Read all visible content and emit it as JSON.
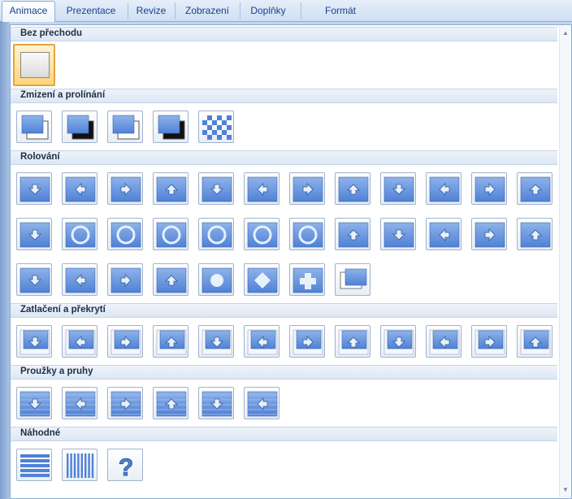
{
  "tabs": [
    {
      "label": "Animace",
      "active": true
    },
    {
      "label": "Prezentace"
    },
    {
      "label": "Revize"
    },
    {
      "label": "Zobrazení"
    },
    {
      "label": "Doplňky"
    },
    {
      "label": "Formát"
    }
  ],
  "sections": [
    {
      "title": "Bez přechodu",
      "items": [
        {
          "icon": "no-transition-icon"
        }
      ]
    },
    {
      "title": "Zmizení a prolínání",
      "items": [
        {
          "icon": "fade-smoothly-icon"
        },
        {
          "icon": "fade-through-black-icon"
        },
        {
          "icon": "cut-icon"
        },
        {
          "icon": "cut-through-black-icon"
        },
        {
          "icon": "dissolve-icon"
        }
      ]
    },
    {
      "title": "Rolování",
      "items": [
        {
          "icon": "wipe-down-icon"
        },
        {
          "icon": "wipe-left-icon"
        },
        {
          "icon": "wipe-right-icon"
        },
        {
          "icon": "wipe-up-icon"
        },
        {
          "icon": "wedge-icon"
        },
        {
          "icon": "uncover-down-icon"
        },
        {
          "icon": "uncover-left-icon"
        },
        {
          "icon": "uncover-right-icon"
        },
        {
          "icon": "uncover-up-icon"
        },
        {
          "icon": "uncover-left-down-icon"
        },
        {
          "icon": "uncover-right-down-icon"
        },
        {
          "icon": "cover-right-down-icon"
        },
        {
          "icon": "cover-left-up-icon"
        },
        {
          "icon": "box-in-icon"
        },
        {
          "icon": "box-out-icon"
        },
        {
          "icon": "wheel-clockwise-icon"
        },
        {
          "icon": "wheel-2-spokes-icon"
        },
        {
          "icon": "wheel-3-spokes-icon"
        },
        {
          "icon": "wheel-4-spokes-icon"
        },
        {
          "icon": "wheel-8-spokes-icon"
        },
        {
          "icon": "split-horizontal-in-icon"
        },
        {
          "icon": "split-horizontal-out-icon"
        },
        {
          "icon": "split-vertical-in-icon"
        },
        {
          "icon": "split-vertical-out-icon"
        },
        {
          "icon": "strips-left-down-icon"
        },
        {
          "icon": "strips-left-up-icon"
        },
        {
          "icon": "strips-right-down-icon"
        },
        {
          "icon": "strips-right-up-icon"
        },
        {
          "icon": "shape-circle-icon"
        },
        {
          "icon": "shape-diamond-icon"
        },
        {
          "icon": "shape-plus-icon"
        },
        {
          "icon": "newsflash-icon"
        }
      ]
    },
    {
      "title": "Zatlačení a překrytí",
      "items": [
        {
          "icon": "push-down-icon"
        },
        {
          "icon": "push-left-icon"
        },
        {
          "icon": "push-right-icon"
        },
        {
          "icon": "push-up-icon"
        },
        {
          "icon": "cover-down-icon"
        },
        {
          "icon": "cover-left-icon"
        },
        {
          "icon": "cover-right-icon"
        },
        {
          "icon": "cover-up-icon"
        },
        {
          "icon": "cover-left-down-icon"
        },
        {
          "icon": "cover-left-up-2-icon"
        },
        {
          "icon": "cover-right-down-2-icon"
        },
        {
          "icon": "cover-right-up-icon"
        }
      ]
    },
    {
      "title": "Proužky a pruhy",
      "items": [
        {
          "icon": "blinds-horizontal-icon"
        },
        {
          "icon": "blinds-vertical-icon"
        },
        {
          "icon": "checkerboard-across-icon"
        },
        {
          "icon": "checkerboard-down-icon"
        },
        {
          "icon": "comb-horizontal-icon"
        },
        {
          "icon": "comb-vertical-icon"
        }
      ]
    },
    {
      "title": "Náhodné",
      "items": [
        {
          "icon": "random-bars-horizontal-icon"
        },
        {
          "icon": "random-bars-vertical-icon"
        },
        {
          "icon": "random-transition-icon",
          "glyph": "?"
        }
      ]
    }
  ],
  "colors": {
    "accent": "#4f81d6",
    "selected_border": "#e3a53d"
  }
}
